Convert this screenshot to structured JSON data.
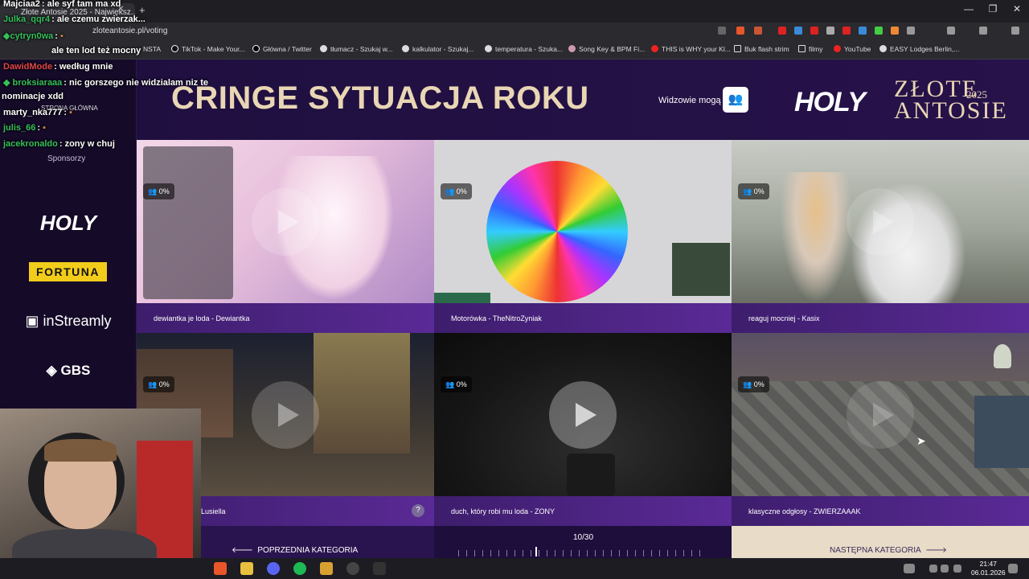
{
  "browser": {
    "tab_title": "Złote Antosie 2025 - Największ...",
    "url": "zloteantosie.pl/voting",
    "bookmarks": [
      "NSTA",
      "TikTok - Make Your...",
      "Główna / Twitter",
      "tłumacz - Szukaj w...",
      "kalkulator - Szukaj...",
      "temperatura - Szuka...",
      "Song Key & BPM Fi...",
      "THIS is WHY your Kl...",
      "Buk flash strim",
      "filmy",
      "YouTube",
      "EASY Lodges Berlin,..."
    ]
  },
  "header": {
    "category_title": "CRINGE SYTUACJA ROKU",
    "viewers_label": "Widzowie mogą",
    "logo_holy": "HOLY",
    "logo_zlote": "ZŁOTE",
    "logo_antosie": "ANTOSIE",
    "logo_year": "2025"
  },
  "sidebar": {
    "home_link": "STRONA GŁÓWNA",
    "sponsors_label": "Sponsorzy",
    "sponsors": [
      "HOLY",
      "FORTUNA",
      "inStreamly",
      "GBS"
    ]
  },
  "cards": [
    {
      "label": "dewiantka je loda - Dewiantka",
      "votes": "0%"
    },
    {
      "label": "Motorówka - TheNitroZyniak",
      "votes": "0%"
    },
    {
      "label": "reaguj mocniej - Kasix",
      "votes": "0%"
    },
    {
      "label": "Lusiella",
      "votes": "0%"
    },
    {
      "label": "duch, który robi mu loda - ZONY",
      "votes": "0%"
    },
    {
      "label": "klasyczne odgłosy - ZWIERZAAAK",
      "votes": "0%"
    }
  ],
  "footer": {
    "prev_label": "POPRZEDNIA KATEGORIA",
    "progress": "10/30",
    "progress_fraction": 0.33,
    "next_label": "NASTĘPNA KATEGORIA"
  },
  "chat": [
    {
      "user": "Majciaa2",
      "text": ": ale syf tam ma xd",
      "color": "#ffffff"
    },
    {
      "user": "Julka_qqr4",
      "text": ": ale czemu zwierzak...",
      "color": "#36c05a"
    },
    {
      "user": "cytryn0wa",
      "text": ":",
      "color": "#36c05a"
    },
    {
      "user": "",
      "text": "ale ten lod też mocny",
      "color": "#e04848"
    },
    {
      "user": "DawidMode",
      "text": ": według mnie",
      "color": "#e04848"
    },
    {
      "user": "broksiaraaa",
      "text": ": nic gorszego nie widzialam niz te",
      "color": "#36c05a"
    },
    {
      "user": "",
      "text": "nominacje xdd",
      "color": "#ffffff"
    },
    {
      "user": "marty_nka777",
      "text": ":",
      "color": "#ffffff"
    },
    {
      "user": "julis_66",
      "text": ":",
      "color": "#36c05a"
    },
    {
      "user": "jacekronaldo",
      "text": ": zony w chuj",
      "color": "#36c05a"
    }
  ],
  "clock": {
    "time": "21:47",
    "date": "06.01.2026"
  },
  "colors": {
    "accent": "#5a2a96",
    "title": "#e9d6b4",
    "page_bg": "#160c2b"
  }
}
